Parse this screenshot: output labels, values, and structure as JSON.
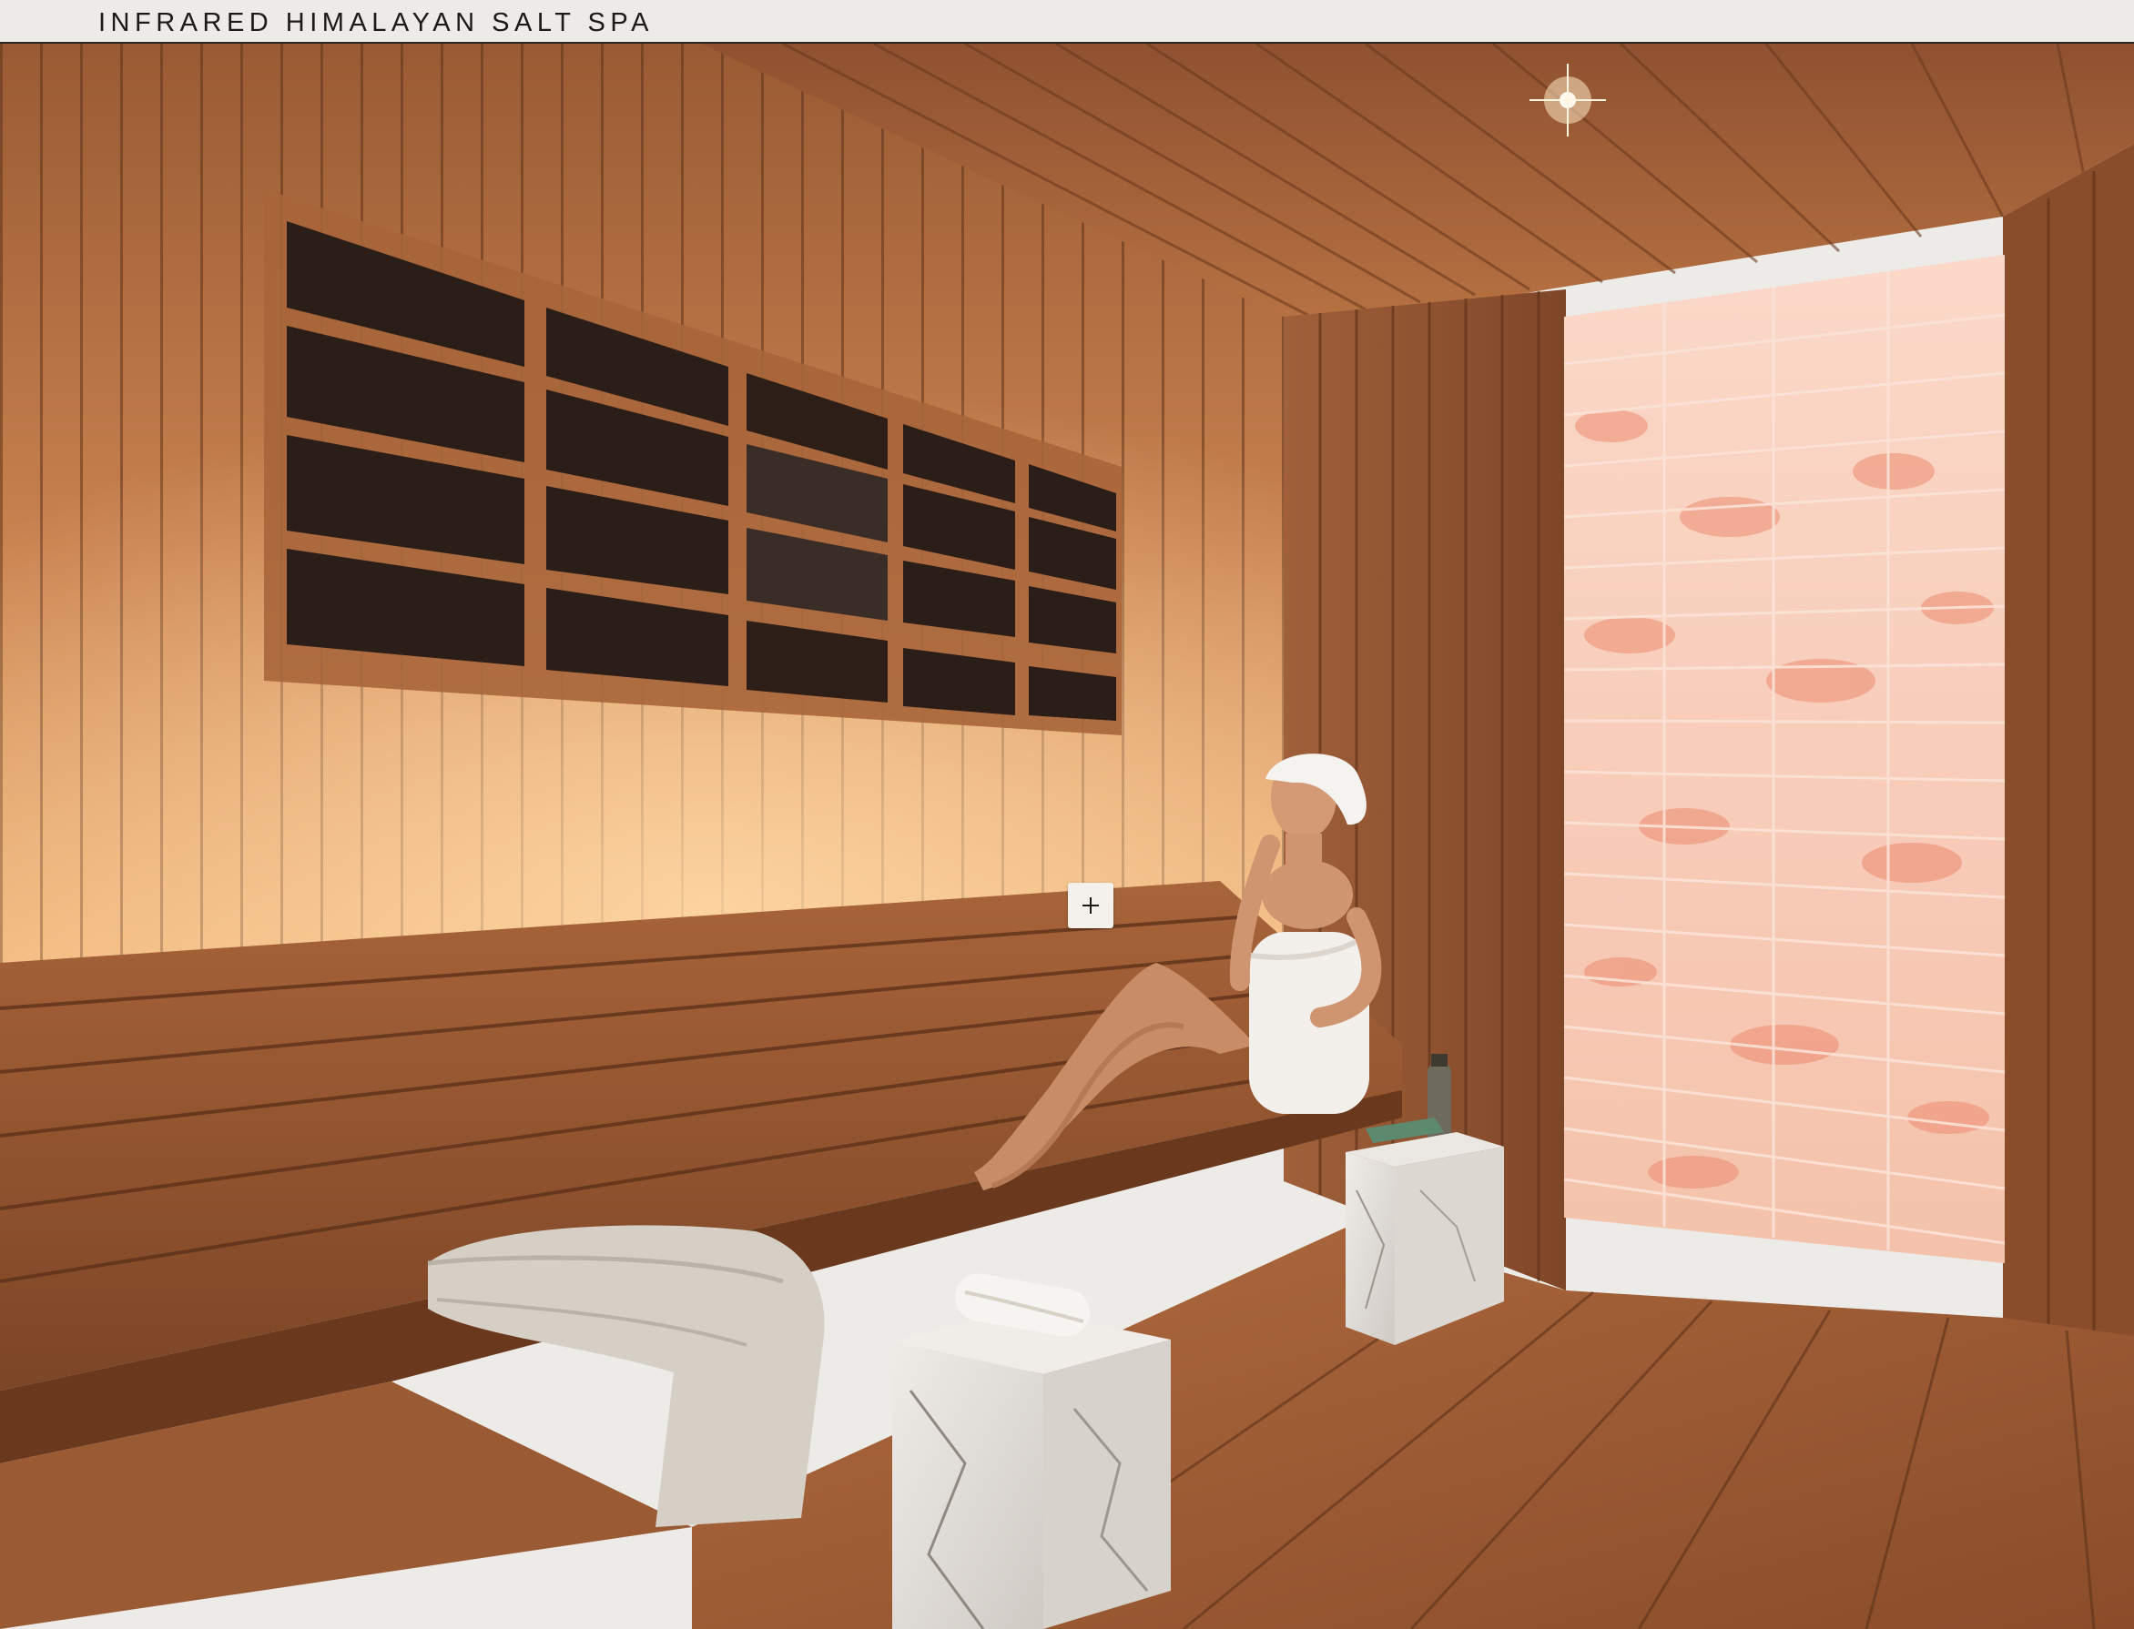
{
  "header": {
    "title": "INFRARED HIMALAYAN SALT SPA"
  },
  "image": {
    "zoom_control": "plus-icon"
  },
  "colors": {
    "header_bg": "#ecebe8",
    "header_text": "#1c1917",
    "wood_light": "#e8a66b",
    "wood_mid": "#b87446",
    "wood_dark": "#7a4424",
    "salt_pink": "#f6cbb8",
    "salt_red": "#e8735a",
    "marble": "#e7e4e0"
  }
}
